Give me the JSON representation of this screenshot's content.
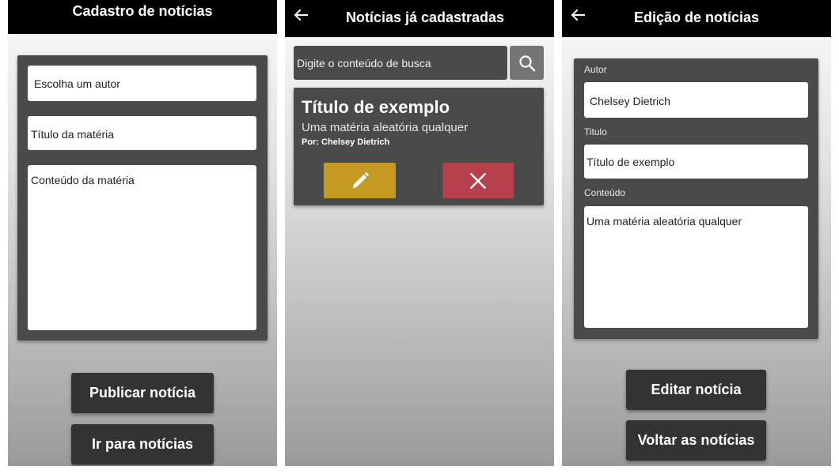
{
  "screen_cadastro": {
    "title": "Cadastro de notícias",
    "author_select": "Escolha um autor",
    "title_placeholder": "Título da matéria",
    "content_placeholder": "Conteúdo da matéria",
    "publish_button": "Publicar notícia",
    "goto_button": "Ir para notícias"
  },
  "screen_lista": {
    "title": "Notícias já cadastradas",
    "search_placeholder": "Digite o conteúdo de busca",
    "card": {
      "title": "Título de exemplo",
      "subtitle": "Uma matéria aleatória qualquer",
      "author": "Por: Chelsey Dietrich"
    }
  },
  "screen_edicao": {
    "title": "Edição de notícias",
    "author_label": "Autor",
    "author_value": "Chelsey Dietrich",
    "title_label": "Titulo",
    "title_value": "Título de exemplo",
    "content_label": "Conteúdo",
    "content_value": "Uma matéria aleatória qualquer",
    "edit_button": "Editar notícia",
    "back_button": "Voltar as notícias"
  },
  "icons": {
    "back": "arrow-left-icon",
    "search": "search-icon",
    "edit": "pencil-icon",
    "delete": "close-icon"
  },
  "colors": {
    "appbar": "#000000",
    "panel": "#4a4a4a",
    "edit_button": "#c59a22",
    "delete_button": "#b5404c",
    "search_button": "#757575"
  }
}
